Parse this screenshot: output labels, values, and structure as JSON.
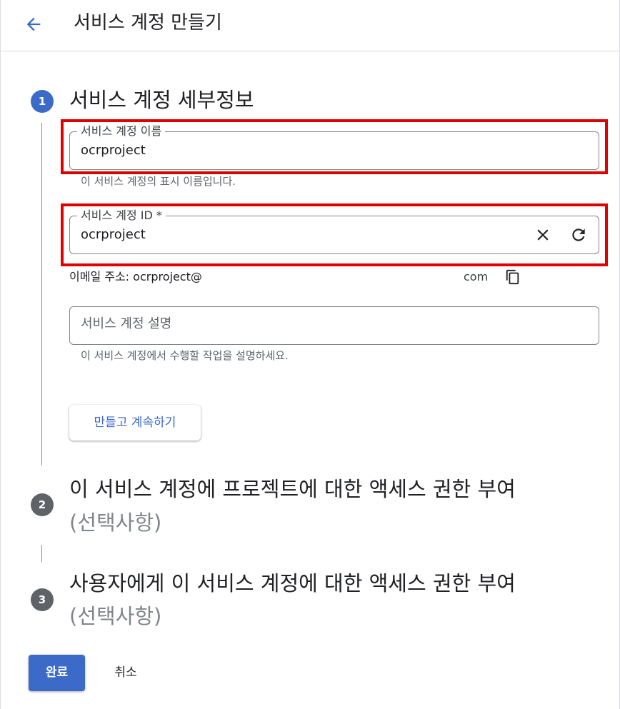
{
  "header": {
    "title": "서비스 계정 만들기",
    "back_icon": "arrow-back-icon"
  },
  "steps": [
    {
      "number": "1",
      "title": "서비스 계정 세부정보",
      "state": "active"
    },
    {
      "number": "2",
      "title": "이 서비스 계정에 프로젝트에 대한 액세스 권한 부여",
      "subtitle": "(선택사항)",
      "state": "inactive"
    },
    {
      "number": "3",
      "title": "사용자에게 이 서비스 계정에 대한 액세스 권한 부여",
      "subtitle": "(선택사항)",
      "state": "inactive"
    }
  ],
  "form": {
    "name_field": {
      "label": "서비스 계정 이름",
      "value": "ocrproject",
      "helper": "이 서비스 계정의 표시 이름입니다."
    },
    "id_field": {
      "label": "서비스 계정 ID *",
      "value": "ocrproject",
      "clear_icon": "close-icon",
      "refresh_icon": "refresh-icon"
    },
    "email": {
      "prefix": "이메일 주소: ocrproject@",
      "domain_suffix": "com",
      "copy_icon": "copy-icon"
    },
    "description_field": {
      "placeholder": "서비스 계정 설명",
      "value": "",
      "helper": "이 서비스 계정에서 수행할 작업을 설명하세요."
    },
    "create_continue_label": "만들고 계속하기"
  },
  "footer": {
    "done_label": "완료",
    "cancel_label": "취소"
  },
  "colors": {
    "primary": "#3c6ac9",
    "inactive_step": "#5f6368",
    "highlight": "#e00000"
  }
}
